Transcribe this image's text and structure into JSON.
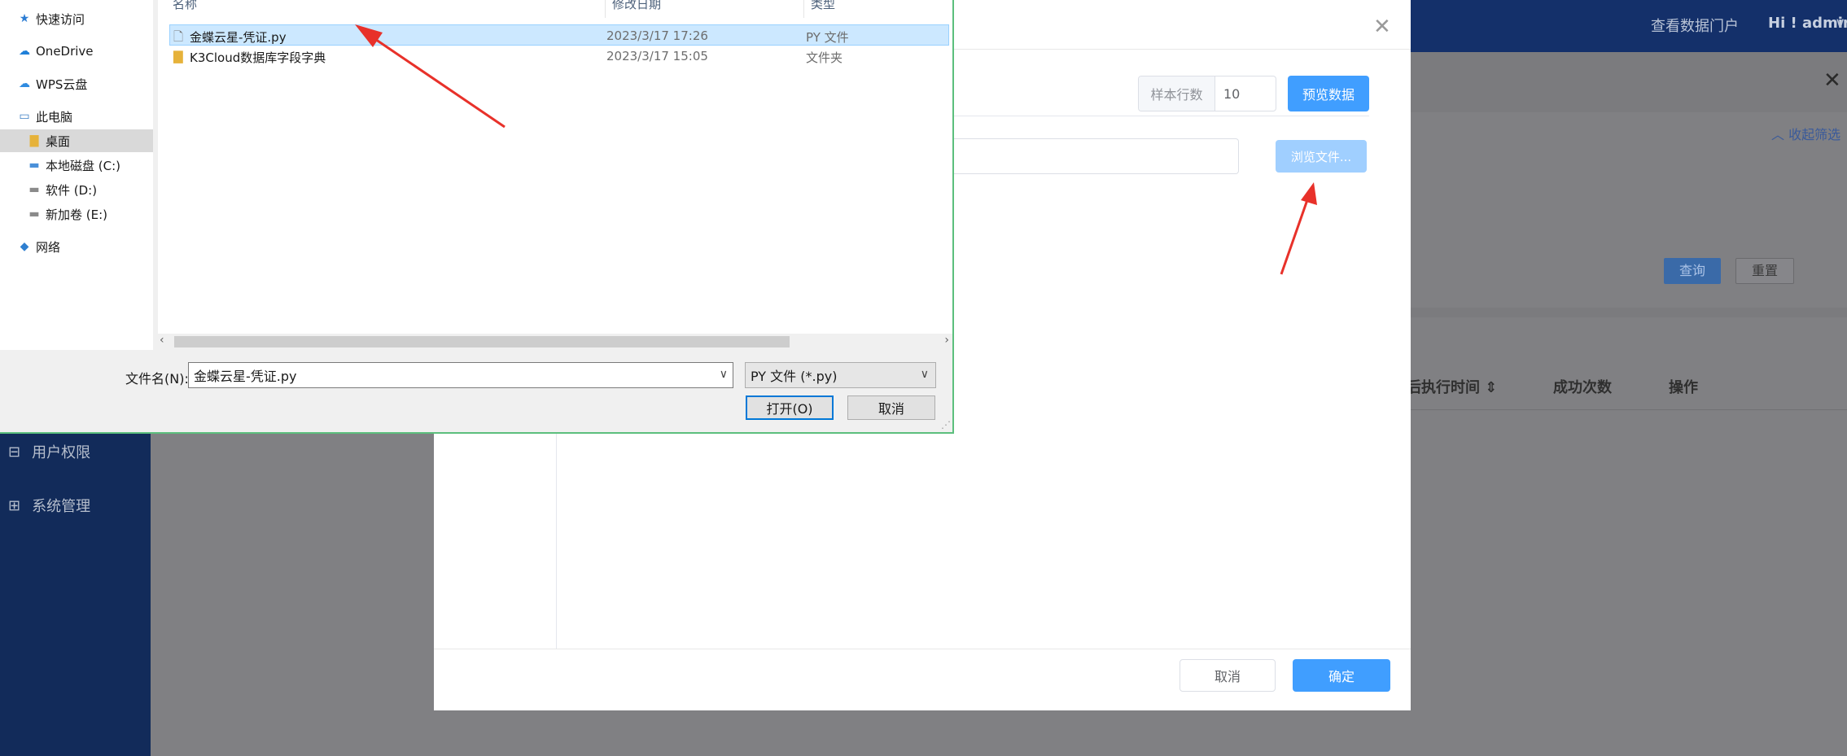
{
  "app": {
    "header": {
      "portal_link": "查看数据门户",
      "greeting": "Hi ! admin",
      "greeting_caret": "∨"
    },
    "sidebar": {
      "items": [
        {
          "label": "用户权限",
          "icon": "users-icon"
        },
        {
          "label": "系统管理",
          "icon": "settings-icon"
        }
      ]
    },
    "filter": {
      "collapse_label": "︿ 收起筛选",
      "query_label": "查询",
      "reset_label": "重置"
    },
    "table": {
      "columns": [
        "最后执行时间 ⇕",
        "成功次数",
        "操作"
      ],
      "visible_columns": [
        "后执行时间 ⇕",
        "成功次数",
        "操作"
      ]
    },
    "close_glyph": "✕"
  },
  "modal": {
    "close_glyph": "✕",
    "sample_rows_label": "样本行数",
    "sample_rows_value": "10",
    "preview_button": "预览数据",
    "browse_button": "浏览文件...",
    "cancel_button": "取消",
    "ok_button": "确定"
  },
  "file_dialog": {
    "nav": [
      {
        "label": "快速访问",
        "icon": "star-icon"
      },
      {
        "label": "OneDrive",
        "icon": "cloud-icon"
      },
      {
        "label": "WPS云盘",
        "icon": "cloud-icon"
      },
      {
        "label": "此电脑",
        "icon": "computer-icon"
      },
      {
        "label": "桌面",
        "icon": "folder-icon"
      },
      {
        "label": "本地磁盘 (C:)",
        "icon": "drive-icon"
      },
      {
        "label": "软件 (D:)",
        "icon": "drive-icon"
      },
      {
        "label": "新加卷 (E:)",
        "icon": "drive-icon"
      },
      {
        "label": "网络",
        "icon": "network-icon"
      }
    ],
    "columns": {
      "name": "名称",
      "modified": "修改日期",
      "type": "类型"
    },
    "files": [
      {
        "name": "金蝶云星-凭证.py",
        "modified": "2023/3/17 17:26",
        "type": "PY 文件",
        "icon": "file-icon"
      },
      {
        "name": "K3Cloud数据库字段字典",
        "modified": "2023/3/17 15:05",
        "type": "文件夹",
        "icon": "folder-icon"
      }
    ],
    "filename_label": "文件名(N):",
    "filename_value": "金蝶云星-凭证.py",
    "filetype_value": "PY 文件 (*.py)",
    "open_button": "打开(O)",
    "cancel_button": "取消"
  },
  "colors": {
    "accent": "#409eff",
    "arrow": "#e8312a",
    "sidebar": "#122b5a",
    "selection": "#cce8ff"
  }
}
